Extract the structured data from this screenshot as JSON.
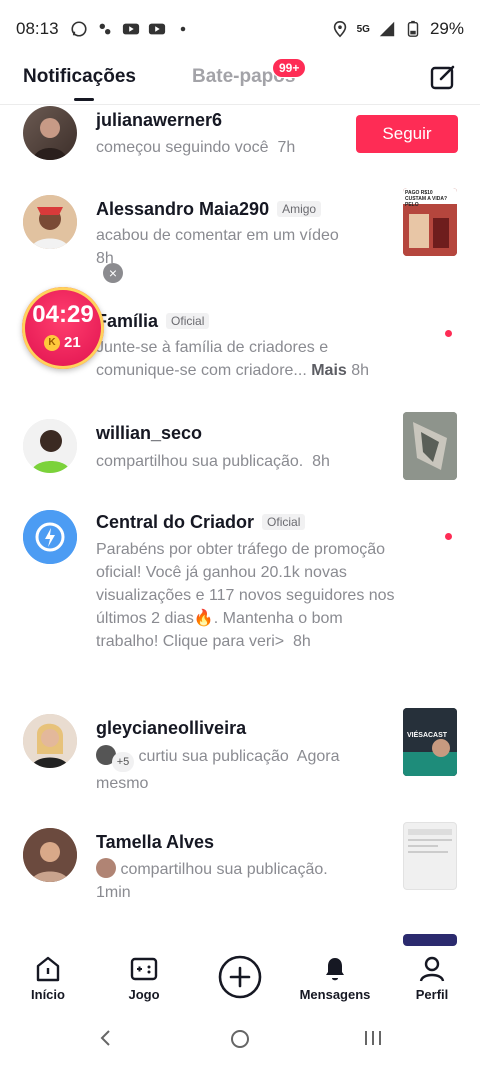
{
  "status": {
    "time": "08:13",
    "network": "5G",
    "battery": "29%"
  },
  "tabs": {
    "notifications": "Notificações",
    "chats": "Bate-papos",
    "chats_badge": "99+"
  },
  "timer": {
    "time": "04:29",
    "coin_symbol": "K",
    "coins": "21"
  },
  "notifications": [
    {
      "name": "julianawerner6",
      "text": "começou seguindo você",
      "time": "7h",
      "action": "Seguir"
    },
    {
      "name": "Alessandro Maia290",
      "tag": "Amigo",
      "text": "acabou de comentar em um vídeo",
      "time": "8h",
      "thumb_text": "PAGO R$10 CUSTAM A VIDA? PELO"
    },
    {
      "name": "Família",
      "tag": "Oficial",
      "text": "Junte-se à família de criadores e comunique-se com criadore...",
      "more": "Mais",
      "time": "8h"
    },
    {
      "name": "willian_seco",
      "text": "compartilhou sua publicação.",
      "time": "8h"
    },
    {
      "name": "Central do Criador",
      "tag": "Oficial",
      "text": "Parabéns por obter tráfego de promoção oficial! Você já ganhou 20.1k novas visualizações e 117 novos seguidores nos últimos 2 dias🔥. Mantenha o bom trabalho! Clique para veri>",
      "time": "8h"
    },
    {
      "name": "gleycianeolliveira",
      "extra_count": "+5",
      "text": "curtiu sua publicação",
      "time": "Agora mesmo",
      "thumb_text": "VIÉSACAST"
    },
    {
      "name": "Tamella Alves",
      "text": "compartilhou sua publicação.",
      "time": "1min"
    }
  ],
  "nav": {
    "home": "Início",
    "game": "Jogo",
    "messages": "Mensagens",
    "profile": "Perfil"
  }
}
